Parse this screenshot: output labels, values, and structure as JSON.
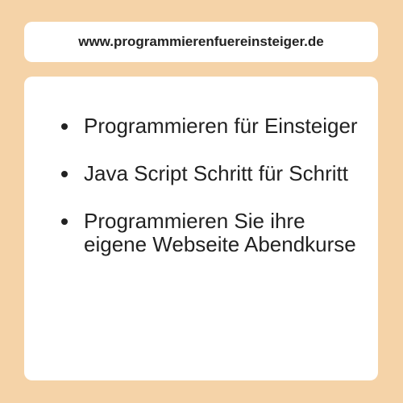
{
  "header": {
    "url": "www.programmierenfuereinsteiger.de"
  },
  "card": {
    "items": [
      {
        "label": "Programmieren für Einsteiger"
      },
      {
        "label": "Java Script Schritt für Schritt"
      },
      {
        "label": "Programmieren Sie ihre eigene Webseite Abendkurse"
      }
    ]
  },
  "colors": {
    "background": "#f5d3a8",
    "panel": "#ffffff",
    "text": "#222222"
  }
}
